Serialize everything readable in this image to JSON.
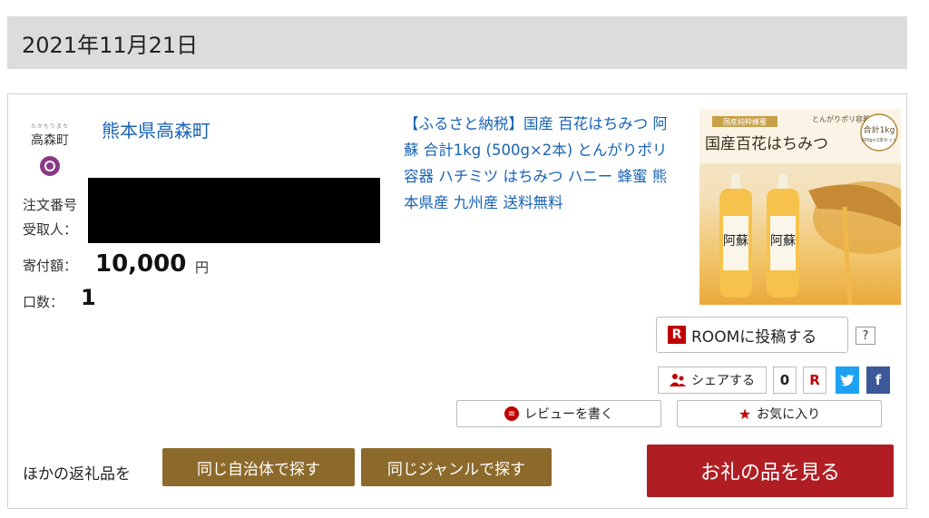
{
  "header": {
    "date": "2021年11月21日"
  },
  "order": {
    "municipality": {
      "logo_ruby": "たかもりまち",
      "logo_name": "高森町",
      "name": "熊本県高森町"
    },
    "order_number_label": "注文番号",
    "recipient_label": "受取人：",
    "donation_label": "寄付額：",
    "donation_amount": "10,000",
    "currency": "円",
    "quantity_label": "口数：",
    "quantity": "1",
    "product": {
      "title": "【ふるさと納税】国産 百花はちみつ 阿蘇 合計1kg (500g×2本) とんがりポリ容器 ハチミツ はちみつ ハニー 蜂蜜 熊本県産 九州産 送料無料",
      "image_banner": "国産百花はちみつ",
      "image_tag": "国産純粋蜂蜜",
      "image_sub": "とんがりポリ容器",
      "image_weight": "合計1kg",
      "image_weight_sub": "500g×2本セット",
      "bottle_label": "阿蘇"
    }
  },
  "social": {
    "room_badge": "R",
    "room_label": "ROOMに投稿する",
    "help": "?",
    "share_label": "シェアする",
    "share_count": "0",
    "rakuten_icon": "R",
    "twitter_icon": "twitter-bird",
    "facebook_icon": "f"
  },
  "actions": {
    "review_label": "レビューを書く",
    "favorite_label": "お気に入り",
    "other_items_label": "ほかの返礼品を",
    "same_muni_label": "同じ自治体で探す",
    "same_genre_label": "同じジャンルで探す",
    "view_item_label": "お礼の品を見る"
  },
  "colors": {
    "link": "#1a63b5",
    "brown_button": "#8c6a2b",
    "primary_button": "#b01e23",
    "rakuten_red": "#bf0000"
  }
}
